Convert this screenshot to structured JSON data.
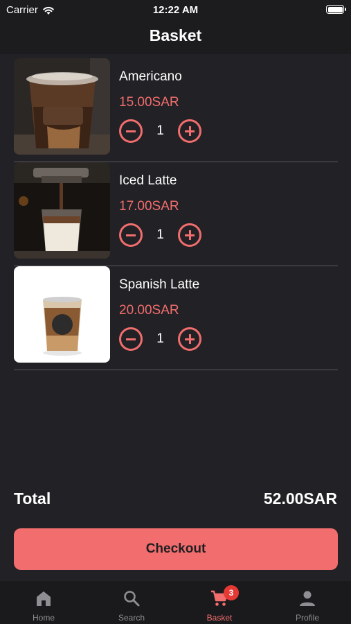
{
  "status_bar": {
    "carrier": "Carrier",
    "time": "12:22 AM"
  },
  "header": {
    "title": "Basket"
  },
  "basket": {
    "items": [
      {
        "name": "Americano",
        "price": "15.00SAR",
        "quantity": "1"
      },
      {
        "name": "Iced Latte",
        "price": "17.00SAR",
        "quantity": "1"
      },
      {
        "name": "Spanish Latte",
        "price": "20.00SAR",
        "quantity": "1"
      }
    ],
    "total_label": "Total",
    "total_value": "52.00SAR",
    "checkout_label": "Checkout"
  },
  "tabbar": {
    "items": [
      {
        "label": "Home",
        "icon": "home-icon"
      },
      {
        "label": "Search",
        "icon": "search-icon"
      },
      {
        "label": "Basket",
        "icon": "cart-icon",
        "badge": "3",
        "active": true
      },
      {
        "label": "Profile",
        "icon": "person-icon"
      }
    ]
  },
  "colors": {
    "accent": "#f26d6d",
    "background": "#222226",
    "badge": "#e53935"
  }
}
